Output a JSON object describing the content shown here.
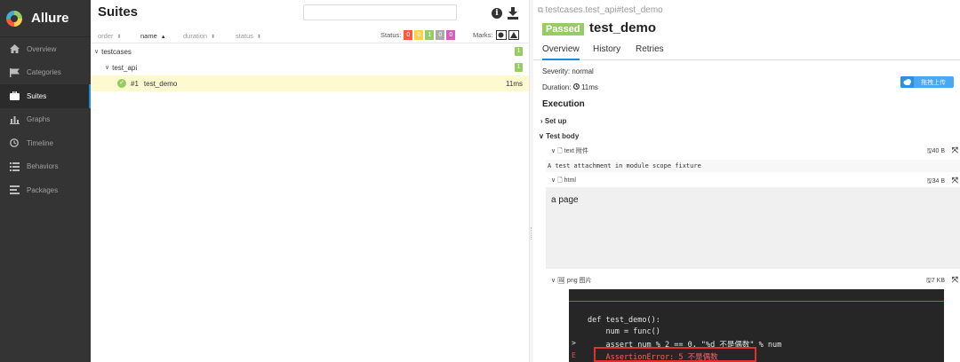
{
  "sidebar": {
    "brand": "Allure",
    "items": [
      {
        "label": "Overview",
        "icon": "home-icon"
      },
      {
        "label": "Categories",
        "icon": "flag-icon"
      },
      {
        "label": "Suites",
        "icon": "briefcase-icon",
        "active": true
      },
      {
        "label": "Graphs",
        "icon": "bar-chart-icon"
      },
      {
        "label": "Timeline",
        "icon": "clock-icon"
      },
      {
        "label": "Behaviors",
        "icon": "list-icon"
      },
      {
        "label": "Packages",
        "icon": "lines-icon"
      }
    ]
  },
  "suites": {
    "title": "Suites",
    "sort": {
      "order": "order",
      "name": "name",
      "duration": "duration",
      "status": "status"
    },
    "status_label": "Status:",
    "status_badges": [
      {
        "value": "0",
        "color": "#fd5a3e"
      },
      {
        "value": "0",
        "color": "#ffd050"
      },
      {
        "value": "1",
        "color": "#97cc64"
      },
      {
        "value": "0",
        "color": "#aaaaaa"
      },
      {
        "value": "0",
        "color": "#d35ebe"
      }
    ],
    "marks_label": "Marks:",
    "tree": {
      "root": {
        "label": "testcases",
        "count": "1"
      },
      "child": {
        "label": "test_api",
        "count": "1"
      },
      "leaf": {
        "index": "#1",
        "label": "test_demo",
        "duration": "11ms"
      }
    }
  },
  "detail": {
    "breadcrumb": "testcases.test_api#test_demo",
    "status": "Passed",
    "name": "test_demo",
    "tabs": [
      "Overview",
      "History",
      "Retries"
    ],
    "severity": "Severity: normal",
    "duration_label": "Duration:",
    "duration_value": "11ms",
    "upload_label": "拖拽上传",
    "execution": "Execution",
    "setup": "Set up",
    "test_body": "Test body",
    "attachments": [
      {
        "name": "text 附件",
        "size": "40 B",
        "content": "A test attachment in module scope fixture"
      },
      {
        "name": "html",
        "size": "34 B",
        "content": "a page"
      },
      {
        "name": "png 图片",
        "size": "7 KB"
      }
    ],
    "code": {
      "line1": "def test_demo():",
      "line2": "    num = func()",
      "line3": "    assert num % 2 == 0, \"%d 不是偶数\" % num",
      "line4": "    AssertionError: 5 不是偶数",
      "gutter3": ">",
      "gutter4": "E"
    }
  }
}
